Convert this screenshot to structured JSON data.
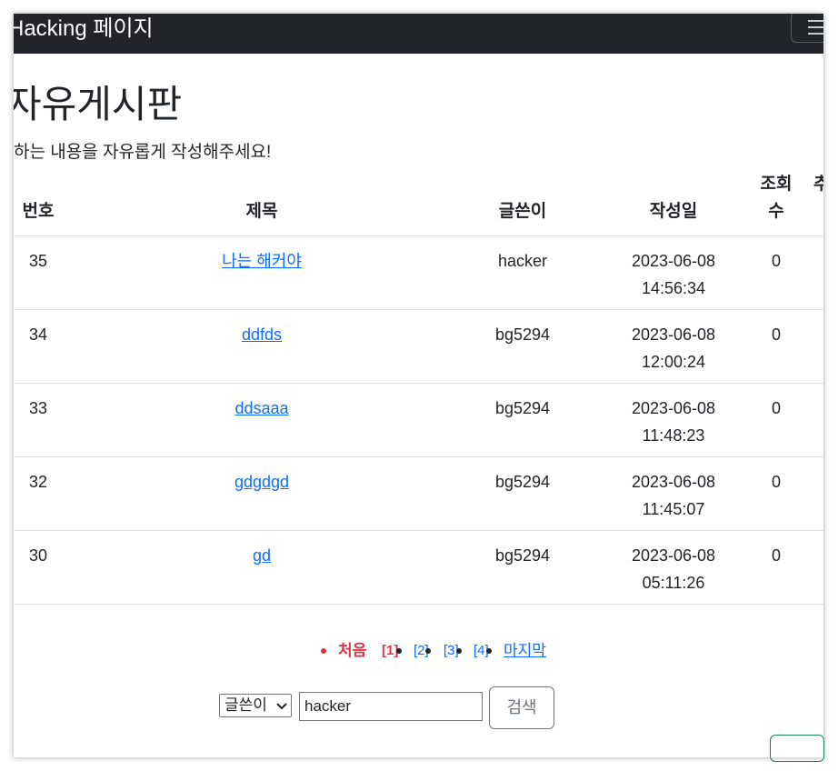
{
  "navbar": {
    "brand": "Hacking 페이지"
  },
  "page": {
    "title": "자유게시판",
    "description": "하는 내용을 자유롭게 작성해주세요!"
  },
  "table": {
    "headers": {
      "number": "번호",
      "title": "제목",
      "author": "글쓴이",
      "date": "작성일",
      "views_line1": "조회",
      "views_line2": "수",
      "extra": "추"
    },
    "rows": [
      {
        "number": "35",
        "title": "나는 해커야",
        "author": "hacker",
        "date": "2023-06-08",
        "time": "14:56:34",
        "views": "0"
      },
      {
        "number": "34",
        "title": "ddfds",
        "author": "bg5294",
        "date": "2023-06-08",
        "time": "12:00:24",
        "views": "0"
      },
      {
        "number": "33",
        "title": "ddsaaa",
        "author": "bg5294",
        "date": "2023-06-08",
        "time": "11:48:23",
        "views": "0"
      },
      {
        "number": "32",
        "title": "gdgdgd",
        "author": "bg5294",
        "date": "2023-06-08",
        "time": "11:45:07",
        "views": "0"
      },
      {
        "number": "30",
        "title": "gd",
        "author": "bg5294",
        "date": "2023-06-08",
        "time": "05:11:26",
        "views": "0"
      }
    ]
  },
  "pagination": {
    "first": "처음",
    "current": "[1]",
    "pages": [
      "[2]",
      "[3]",
      "[4]"
    ],
    "last": "마지막"
  },
  "search": {
    "field_selected": "글쓴이",
    "query": "hacker",
    "button": "검색"
  },
  "colors": {
    "navbar_bg": "#212529",
    "link": "#0d6efd",
    "active_page": "#dc3545",
    "row_border": "#dee2e6"
  }
}
